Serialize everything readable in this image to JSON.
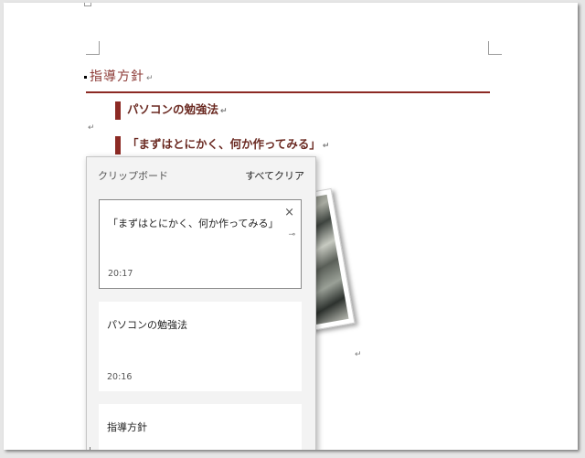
{
  "document": {
    "heading1": "指導方針",
    "heading2a": "パソコンの勉強法",
    "heading2b": "「まずはとにかく、何か作ってみる」",
    "paragraph_mark": "↵",
    "accent_color": "#8c2a24"
  },
  "clipboard": {
    "title": "クリップボード",
    "clear_all": "すべてクリア",
    "close_icon": "×",
    "pin_icon": "⊸",
    "items": [
      {
        "text": "「まずはとにかく、何か作ってみる」",
        "time": "20:17"
      },
      {
        "text": "パソコンの勉強法",
        "time": "20:16"
      },
      {
        "text": "指導方針",
        "time": ""
      }
    ]
  }
}
